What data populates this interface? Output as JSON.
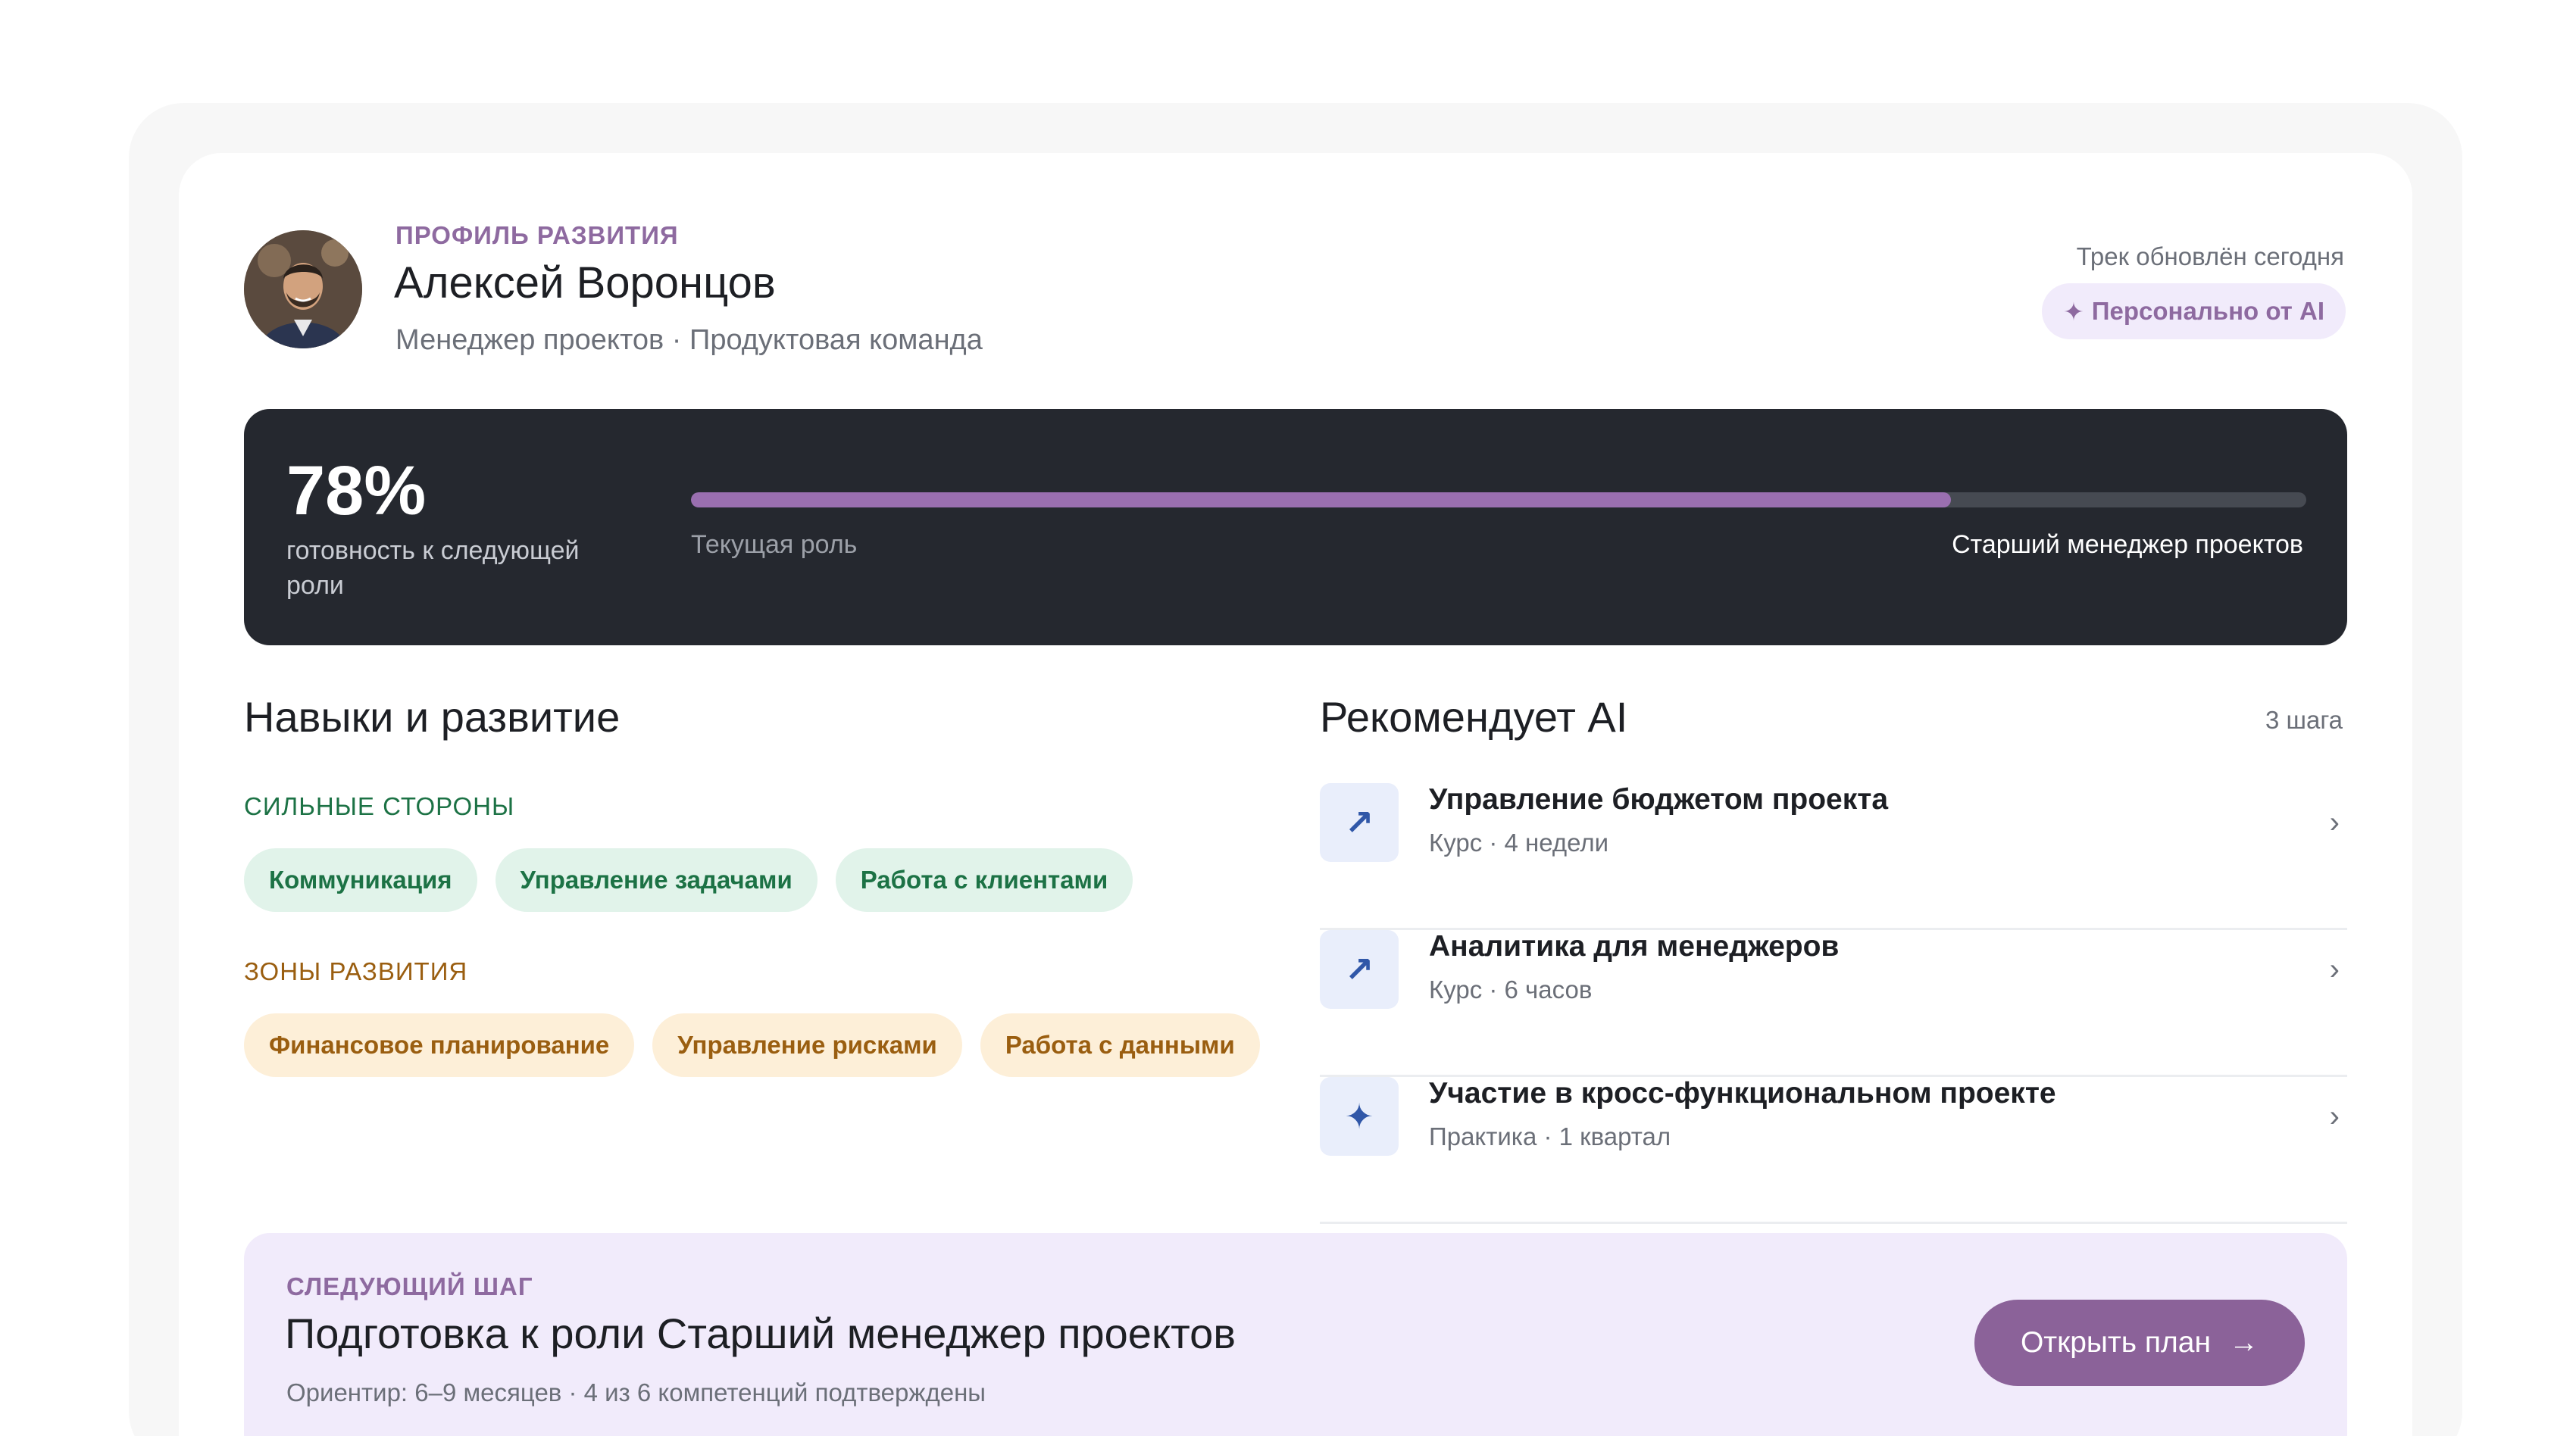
{
  "profile": {
    "eyebrow": "ПРОФИЛЬ РАЗВИТИЯ",
    "name": "Алексей Воронцов",
    "subtitle": "Менеджер проектов · Продуктовая команда",
    "updated": "Трек обновлён сегодня",
    "ai_badge_icon": "sparkle-icon",
    "ai_badge_glyph": "✦",
    "ai_badge_label": "Персонально от AI"
  },
  "readiness": {
    "percent_label": "78%",
    "percent_value": 78,
    "label": "готовность к следующей роли",
    "current_role_label": "Текущая роль",
    "target_role": "Старший менеджер проектов",
    "accent": "#9a6fb0"
  },
  "skills": {
    "title": "Навыки и развитие",
    "strengths_label": "СИЛЬНЫЕ СТОРОНЫ",
    "strengths": [
      "Коммуникация",
      "Управление задачами",
      "Работа с клиентами"
    ],
    "growth_label": "ЗОНЫ РАЗВИТИЯ",
    "growth": [
      "Финансовое планирование",
      "Управление рисками",
      "Работа с данными"
    ]
  },
  "recommendations": {
    "title": "Рекомендует AI",
    "count": "3 шага",
    "items": [
      {
        "icon": "arrow-up-right-icon",
        "glyph": "↗",
        "title": "Управление бюджетом проекта",
        "meta": "Курс · 4 недели",
        "chevron": "›"
      },
      {
        "icon": "arrow-up-right-icon",
        "glyph": "↗",
        "title": "Аналитика для менеджеров",
        "meta": "Курс · 6 часов",
        "chevron": "›"
      },
      {
        "icon": "sparkle-icon",
        "glyph": "✦",
        "title": "Участие в кросс-функциональном проекте",
        "meta": "Практика · 1 квартал",
        "chevron": "›"
      }
    ]
  },
  "next_step": {
    "eyebrow": "СЛЕДУЮЩИЙ ШАГ",
    "title": "Подготовка к роли Старший менеджер проектов",
    "subtitle": "Ориентир: 6–9 месяцев · 4 из 6 компетенций подтверждены",
    "button_label": "Открыть план",
    "button_icon": "arrow-right-icon",
    "button_glyph": "→"
  }
}
